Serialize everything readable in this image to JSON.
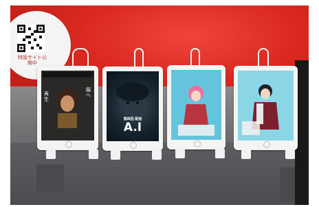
{
  "sign": {
    "caption": "特設サイト公開中"
  },
  "tablets": [
    {
      "screen_text": "再生",
      "side_text": "脳へ"
    },
    {
      "screen_text": "A.I",
      "top_text": "第四回 配信"
    },
    {
      "screen_text": ""
    },
    {
      "screen_text": ""
    }
  ],
  "colors": {
    "wall": "#d9281f",
    "table": "#6f6e71",
    "tablet_frame": "#f4f4f2"
  }
}
